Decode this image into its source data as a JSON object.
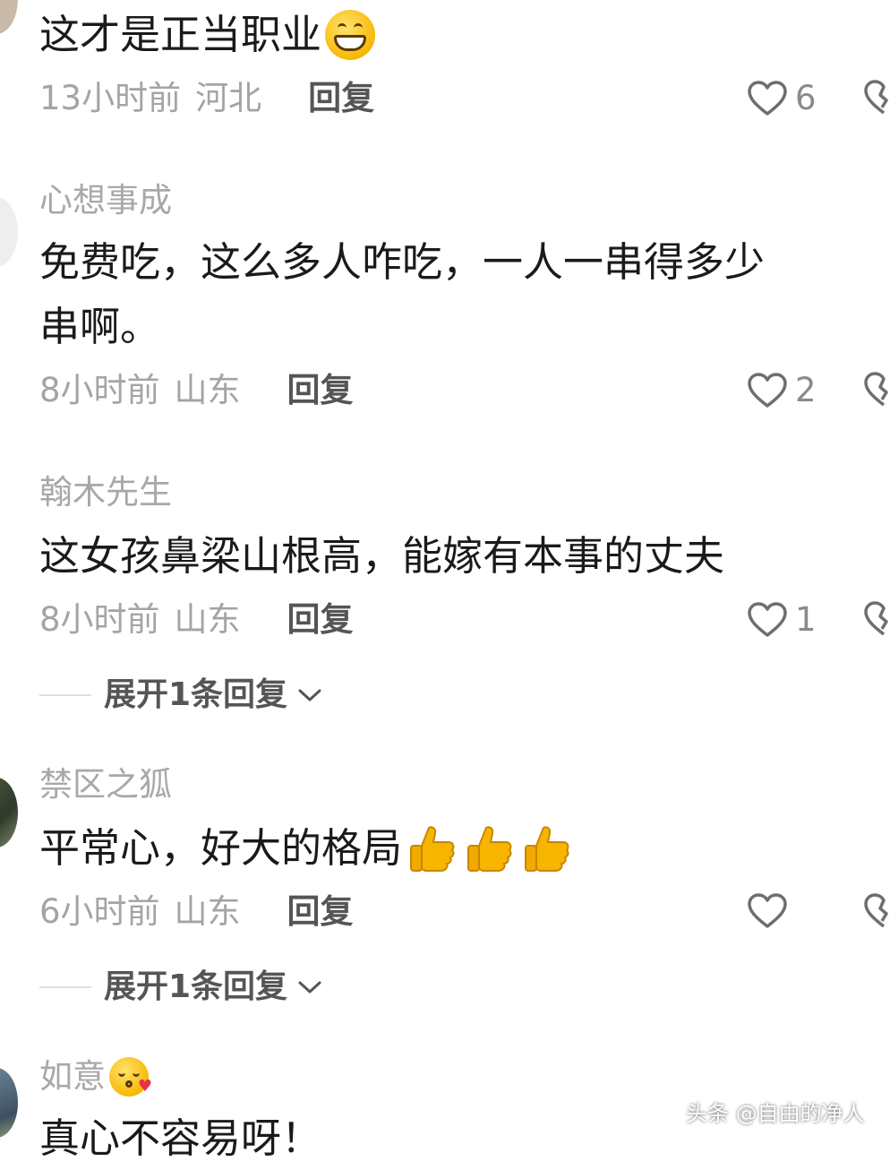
{
  "comments": [
    {
      "username": "",
      "text": "这才是正当职业",
      "emoji": "grinning-face",
      "time": "13小时前",
      "location": "河北",
      "reply_label": "回复",
      "likes": "6"
    },
    {
      "username": "心想事成",
      "text_line1": "免费吃，这么多人咋吃，一人一串得多少",
      "text_line2": "串啊。",
      "time": "8小时前",
      "location": "山东",
      "reply_label": "回复",
      "likes": "2"
    },
    {
      "username": "翰木先生",
      "text": "这女孩鼻梁山根高，能嫁有本事的丈夫",
      "time": "8小时前",
      "location": "山东",
      "reply_label": "回复",
      "likes": "1",
      "expand_label": "展开1条回复"
    },
    {
      "username": "禁区之狐",
      "text": "平常心，好大的格局",
      "emoji": "thumbs-up x3",
      "time": "6小时前",
      "location": "山东",
      "reply_label": "回复",
      "likes": "",
      "expand_label": "展开1条回复"
    },
    {
      "username": "如意",
      "username_emoji": "face-blowing-kiss",
      "text": "真心不容易呀！"
    }
  ],
  "watermark": "头条 @自由的净人",
  "colors": {
    "text_primary": "#1a1a1a",
    "text_secondary": "#a4a4a4",
    "reply": "#555555"
  }
}
